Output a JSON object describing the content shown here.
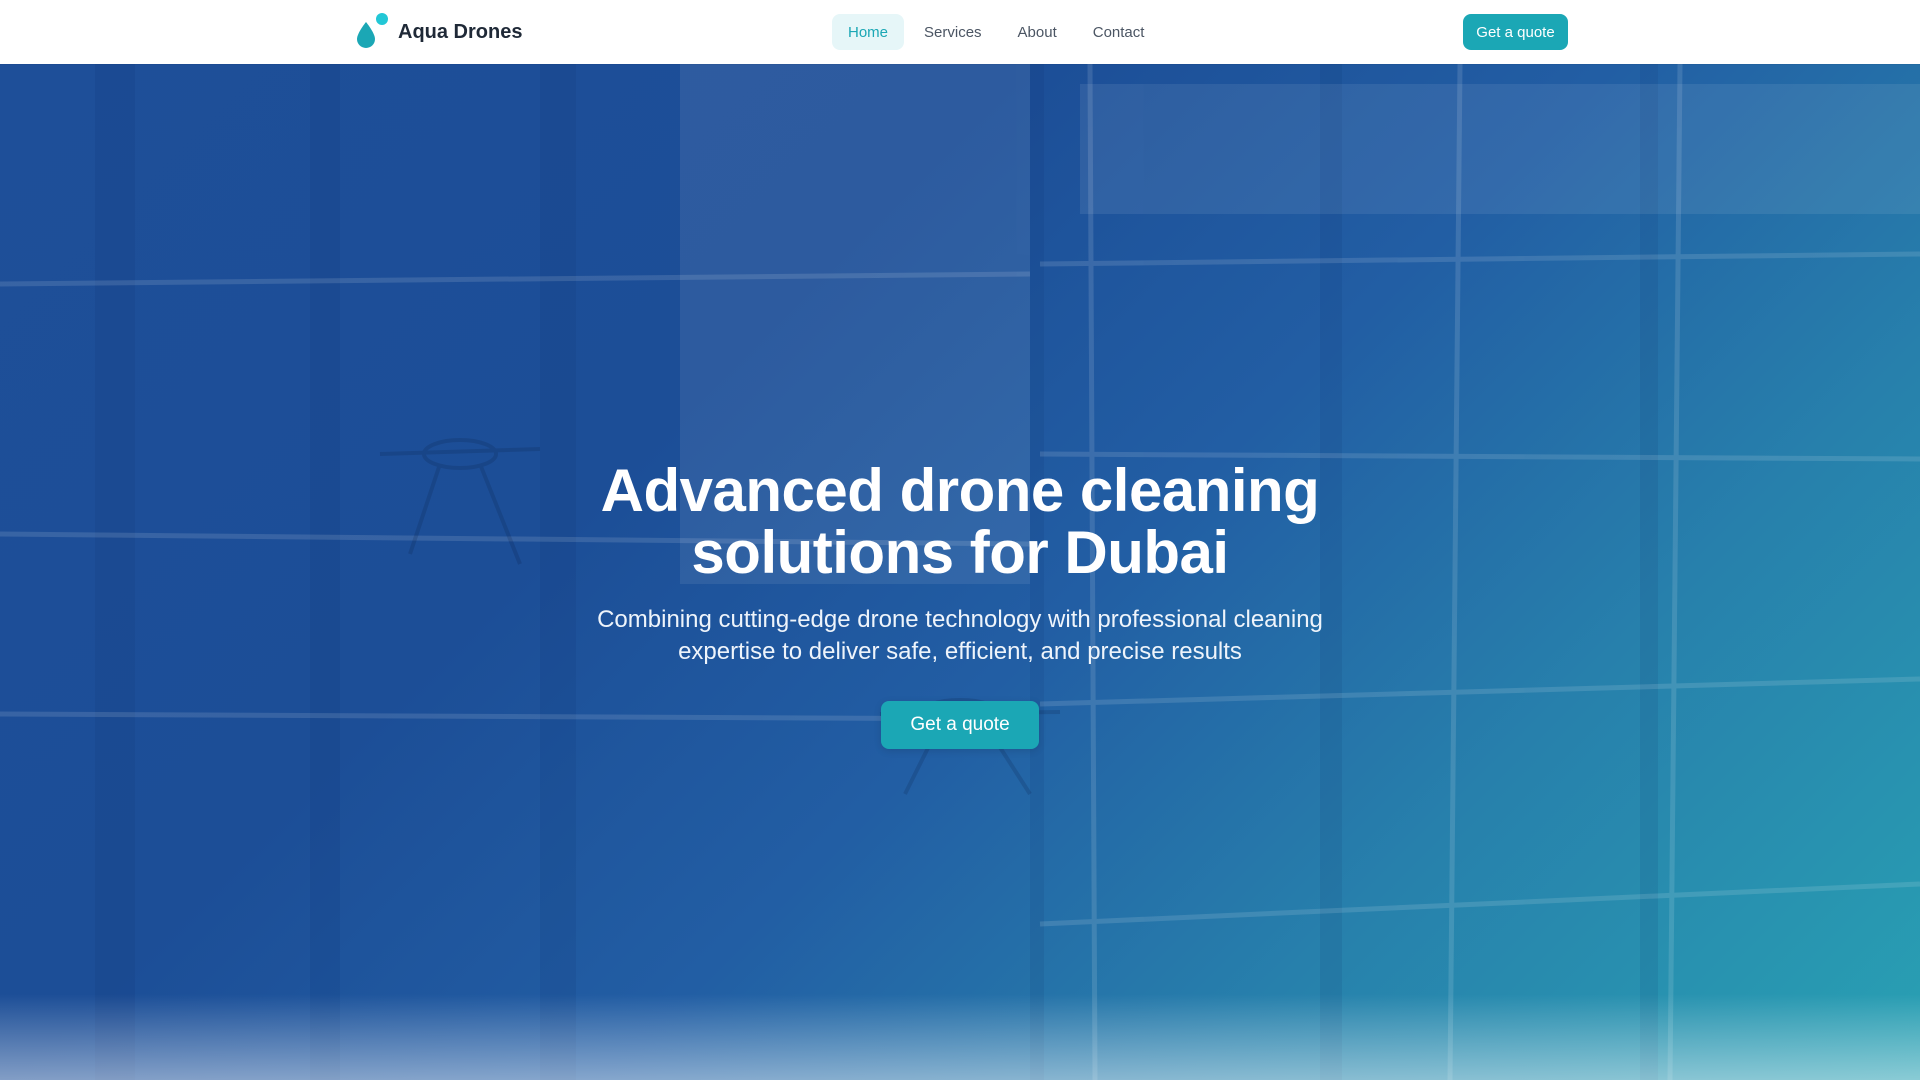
{
  "header": {
    "brand_name": "Aqua Drones",
    "brand_icon": "water-drop-icon",
    "nav": [
      {
        "label": "Home",
        "active": true
      },
      {
        "label": "Services",
        "active": false
      },
      {
        "label": "About",
        "active": false
      },
      {
        "label": "Contact",
        "active": false
      }
    ],
    "cta_label": "Get a quote"
  },
  "hero": {
    "title_line1": "Advanced drone cleaning",
    "title_line2": "solutions for Dubai",
    "subtitle_line1": "Combining cutting-edge drone technology with professional cleaning",
    "subtitle_line2": "expertise to deliver safe, efficient, and precise results",
    "cta_label": "Get a quote"
  },
  "colors": {
    "accent": "#1ba7b5",
    "hero_gradient_start": "#1e4f99",
    "hero_gradient_end": "#29a1b3",
    "brand_text": "#1f2937",
    "nav_text": "#4b5563",
    "nav_active_bg": "#e6f6f8"
  }
}
